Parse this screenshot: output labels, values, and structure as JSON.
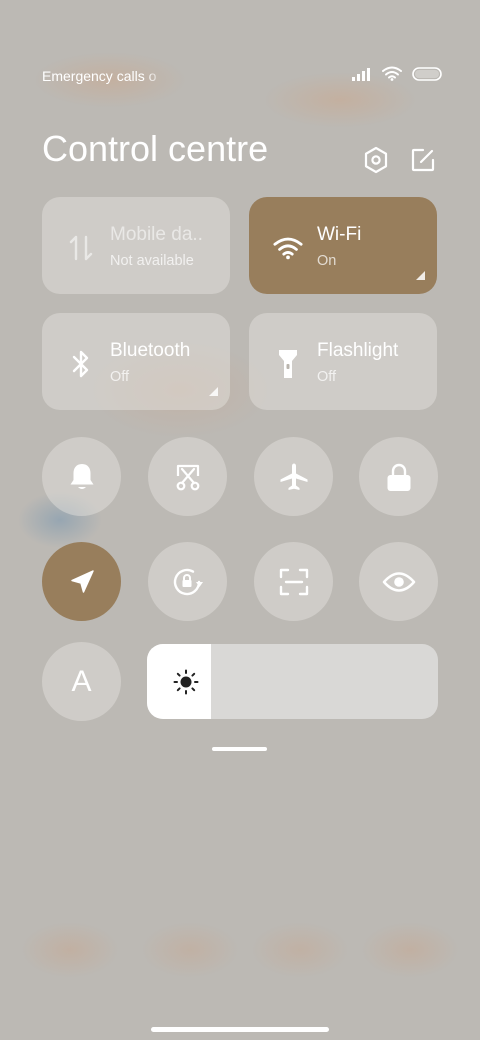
{
  "status_bar": {
    "carrier_text": "Emergency calls o",
    "icons": [
      "signal-icon",
      "wifi-icon",
      "battery-icon"
    ]
  },
  "header": {
    "title": "Control centre",
    "buttons": [
      "settings-icon",
      "edit-icon"
    ]
  },
  "tiles": [
    {
      "id": "mobile-data",
      "label": "Mobile da..",
      "status": "Not available",
      "icon": "mobile-data-icon",
      "active": false
    },
    {
      "id": "wifi",
      "label": "Wi-Fi",
      "status": "On",
      "icon": "wifi-icon",
      "active": true
    },
    {
      "id": "bluetooth",
      "label": "Bluetooth",
      "status": "Off",
      "icon": "bluetooth-icon",
      "active": false
    },
    {
      "id": "flashlight",
      "label": "Flashlight",
      "status": "Off",
      "icon": "flashlight-icon",
      "active": false
    }
  ],
  "toggles": [
    {
      "id": "silent",
      "icon": "bell-icon",
      "active": false
    },
    {
      "id": "screenshot",
      "icon": "scissors-screenshot-icon",
      "active": false
    },
    {
      "id": "airplane",
      "icon": "airplane-icon",
      "active": false
    },
    {
      "id": "lock",
      "icon": "lock-icon",
      "active": false
    },
    {
      "id": "location",
      "icon": "location-arrow-icon",
      "active": true
    },
    {
      "id": "rotation-lock",
      "icon": "rotation-lock-icon",
      "active": false
    },
    {
      "id": "scanner",
      "icon": "scan-icon",
      "active": false
    },
    {
      "id": "reading-mode",
      "icon": "eye-icon",
      "active": false
    },
    {
      "id": "auto-brightness",
      "icon": "letter-a-icon",
      "label": "A",
      "active": false
    }
  ],
  "brightness": {
    "level_fraction": 0.22,
    "icon": "sun-icon"
  },
  "colors": {
    "accent": "#987e5c",
    "tile_background": "#e6e4e0",
    "background": "#bcb9b4",
    "text": "#ffffff"
  }
}
